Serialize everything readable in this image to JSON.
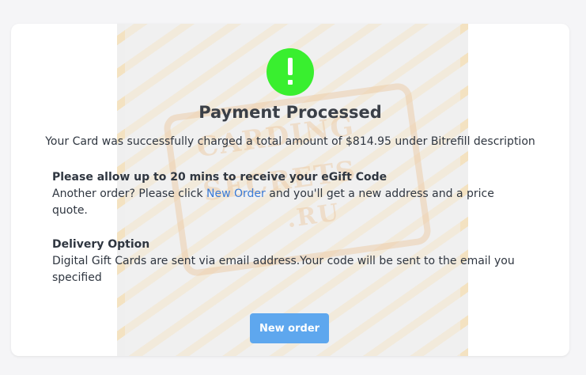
{
  "status": {
    "icon": "exclamation-icon",
    "icon_color": "#39ef2f",
    "title": "Payment Processed",
    "summary": "Your Card was successfully charged a total amount of $814.95 under Bitrefill description"
  },
  "allow": {
    "heading": "Please allow up to 20 mins to receive your eGift Code",
    "text_before": "Another order? Please click ",
    "link_label": "New Order",
    "text_after": " and you'll get a new address and a price quote."
  },
  "delivery": {
    "heading": "Delivery Option",
    "text": "Digital Gift Cards are sent via email address.Your code will be sent to the email you specified"
  },
  "watermark": {
    "line1": "CARDING",
    "line2": "SECRETS",
    "line3": ".RU"
  },
  "button": {
    "label": "New order",
    "color": "#5ea7ee"
  }
}
